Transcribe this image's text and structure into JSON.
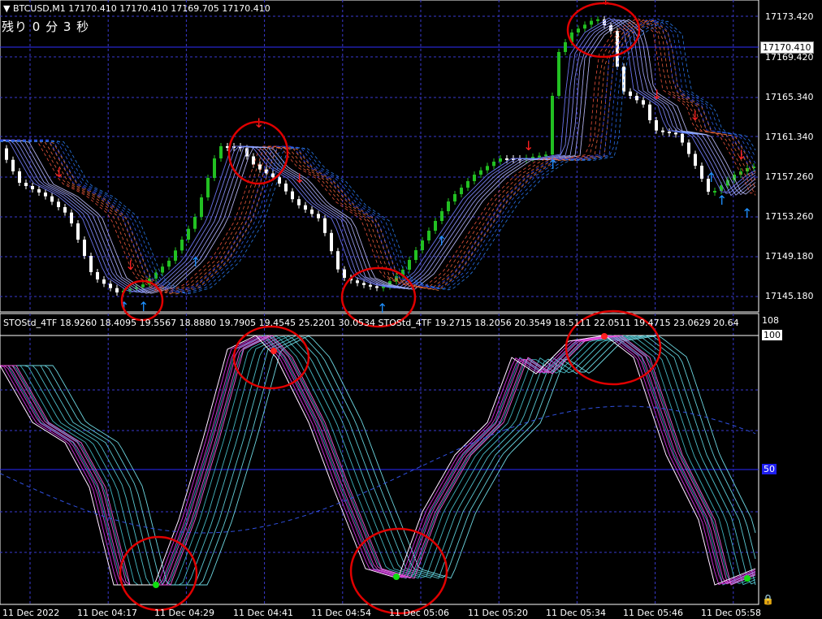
{
  "symbol_line": "BTCUSD,M1  17170.410 17170.410 17169.705 17170.410",
  "remaining": "残り  0 分 3 秒",
  "indicator_line": "STOStd_4TF 18.9260 18.4095 19.5567 18.8880 19.7905 19.4545 25.2201 30.0534  STOStd_4TF 19.2715 18.2056 20.3549 18.5111 22.0511 19.4715 23.0629 20.64",
  "current_price": "17170.410",
  "price_ticks": [
    "17173.420",
    "17169.420",
    "17165.340",
    "17161.340",
    "17157.260",
    "17153.260",
    "17149.180",
    "17145.180"
  ],
  "osc_levels": {
    "top_small": "108",
    "top": "100",
    "mid": "50"
  },
  "time_ticks": [
    "11 Dec 2022",
    "11 Dec 04:17",
    "11 Dec 04:29",
    "11 Dec 04:41",
    "11 Dec 04:54",
    "11 Dec 05:06",
    "11 Dec 05:20",
    "11 Dec 05:34",
    "11 Dec 05:46",
    "11 Dec 05:58"
  ],
  "colors": {
    "bull": "#22c022",
    "bear": "#ffffff",
    "grid": "#3a3ad0",
    "circle": "#e00000",
    "down_arrow": "#ff2020",
    "up_arrow": "#1e90ff"
  },
  "icons": {
    "menu": "triangle-down-icon",
    "lock": "lock-icon"
  }
}
